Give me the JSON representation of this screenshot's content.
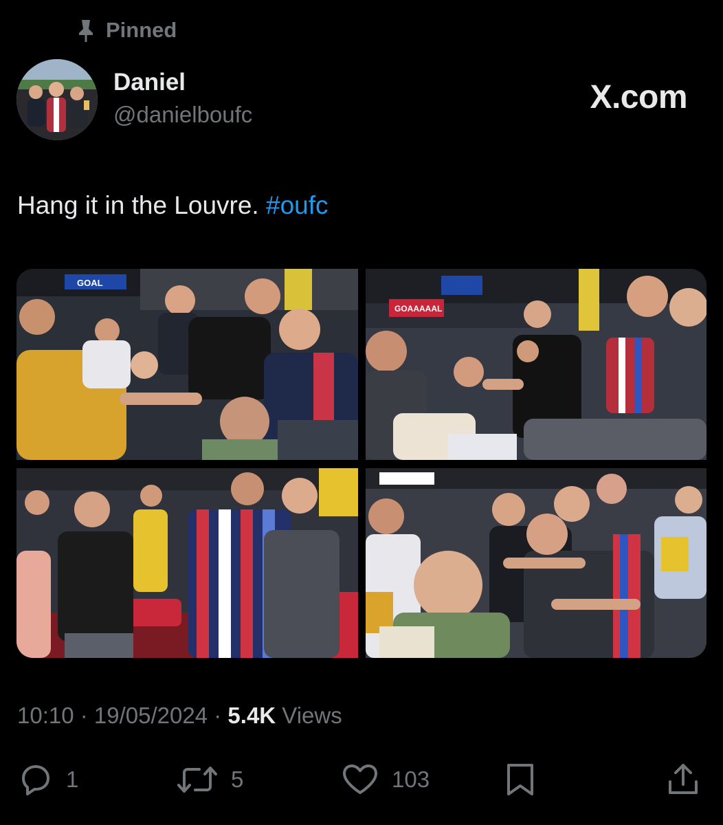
{
  "pinned": {
    "label": "Pinned",
    "icon": "pin-icon"
  },
  "author": {
    "display_name": "Daniel",
    "handle": "@danielboufc",
    "avatar_icon": "avatar-photo"
  },
  "brand": {
    "label": "X.com"
  },
  "tweet": {
    "text": "Hang it in the Louvre.",
    "hashtag": "#oufc"
  },
  "photos": {
    "photo_1": {
      "board_text": "GOAL"
    },
    "photo_2": {
      "board_text": "GOAAAAAL"
    }
  },
  "meta": {
    "time": "10:10",
    "separator_1": " · ",
    "date": "19/05/2024",
    "separator_2": " · ",
    "views_count": "5.4K",
    "views_label": " Views"
  },
  "actions": {
    "reply": {
      "icon": "reply-icon",
      "count": "1"
    },
    "repost": {
      "icon": "repost-icon",
      "count": "5"
    },
    "like": {
      "icon": "heart-icon",
      "count": "103"
    },
    "bookmark": {
      "icon": "bookmark-icon"
    },
    "share": {
      "icon": "share-icon"
    }
  },
  "colors": {
    "background": "#000000",
    "primary_text": "#e7e9ea",
    "secondary_text": "#71767b",
    "hashtag": "#1d9bf0"
  }
}
